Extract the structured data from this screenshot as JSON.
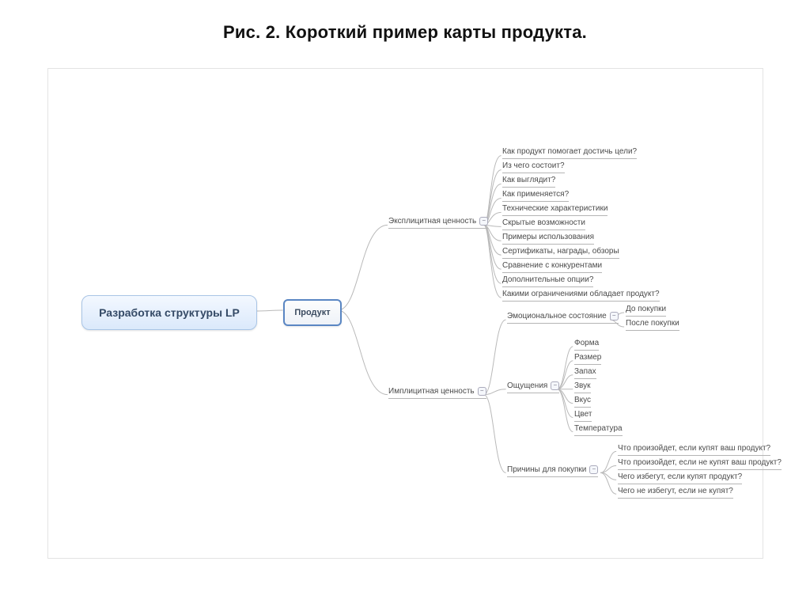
{
  "title": "Рис. 2. Короткий пример карты продукта.",
  "root": {
    "label": "Разработка структуры LP"
  },
  "product": {
    "label": "Продукт"
  },
  "explicit": {
    "label": "Эксплицитная ценность",
    "items": [
      "Как продукт помогает достичь цели?",
      "Из чего состоит?",
      "Как выглядит?",
      "Как применяется?",
      "Технические характеристики",
      "Скрытые возможности",
      "Примеры использования",
      "Сертификаты, награды, обзоры",
      "Сравнение с конкурентами",
      "Дополнительные опции?",
      "Какими ограничениями обладает продукт?"
    ]
  },
  "implicit": {
    "label": "Имплицитная ценность",
    "emotional": {
      "label": "Эмоциональное состояние",
      "items": [
        "До покупки",
        "После покупки"
      ]
    },
    "sensations": {
      "label": "Ощущения",
      "items": [
        "Форма",
        "Размер",
        "Запах",
        "Звук",
        "Вкус",
        "Цвет",
        "Температура"
      ]
    },
    "reasons": {
      "label": "Причины для покупки",
      "items": [
        "Что произойдет, если купят ваш продукт?",
        "Что произойдет, если не купят ваш продукт?",
        "Чего избегут, если купят продукт?",
        "Чего не избегут, если не купят?"
      ]
    }
  }
}
